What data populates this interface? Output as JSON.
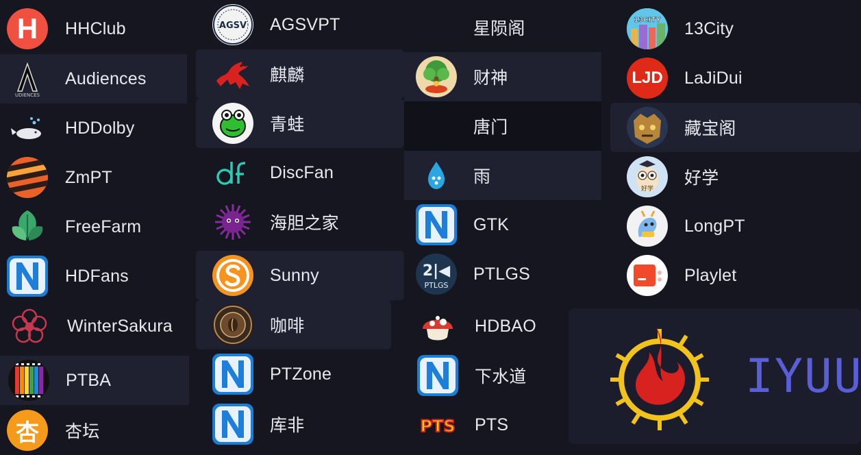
{
  "sites": {
    "hhclub": "HHClub",
    "audiences": "Audiences",
    "hddolby": "HDDolby",
    "zmpt": "ZmPT",
    "freefarm": "FreeFarm",
    "hdfans": "HDFans",
    "wintersakura": "WinterSakura",
    "ptba": "PTBA",
    "xingtan": "杏坛",
    "agsvpt": "AGSVPT",
    "qilin": "麒麟",
    "qingwa": "青蛙",
    "discfan": "DiscFan",
    "haidan": "海胆之家",
    "sunny": "Sunny",
    "kafei": "咖啡",
    "ptzone": "PTZone",
    "kufei": "库非",
    "xingyunge": "星陨阁",
    "caishen": "财神",
    "tangmen": "唐门",
    "yu": "雨",
    "gtk": "GTK",
    "ptlgs": "PTLGS",
    "hdbao": "HDBAO",
    "xiashuidao": "下水道",
    "pts": "PTS",
    "city13": "13City",
    "lajidui": "LaJiDui",
    "cangbaoge": "藏宝阁",
    "haoxue": "好学",
    "longpt": "LongPT",
    "playlet": "Playlet"
  },
  "icon_text": {
    "hhclub": "H",
    "agsv": "AGSV",
    "ljd": "LJD",
    "city13": "13CITY",
    "ptlgs": "PTLGS",
    "pts": "PTS",
    "xingtan": "杏",
    "haoxue": "好学"
  },
  "iyuu": {
    "name": "IYUU"
  },
  "colors": {
    "background": "#15161f",
    "highlight_row": "#1f2030",
    "text": "#e9e9f0",
    "iyuu_blue": "#5a5fd8",
    "hhclub_red": "#f0503f",
    "sunny_orange": "#f7931e",
    "xingtan_orange": "#f59a1b"
  }
}
